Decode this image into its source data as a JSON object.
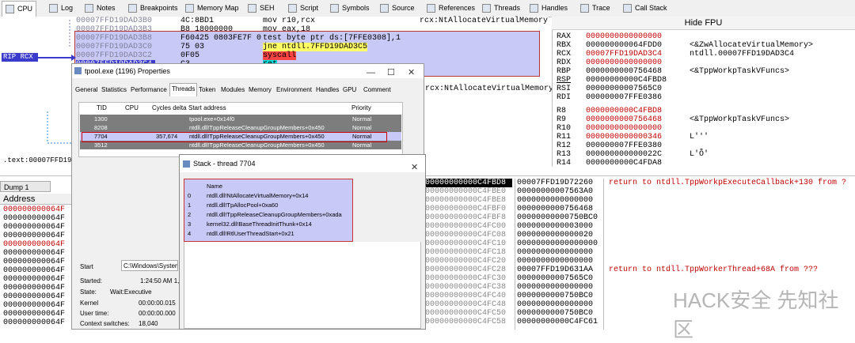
{
  "tabs": [
    {
      "label": "CPU",
      "icon": "cpu-icon",
      "active": true
    },
    {
      "label": "Log",
      "icon": "log-icon"
    },
    {
      "label": "Notes",
      "icon": "notes-icon"
    },
    {
      "label": "Breakpoints",
      "icon": "breakpoint-icon"
    },
    {
      "label": "Memory Map",
      "icon": "memory-map-icon"
    },
    {
      "label": "SEH",
      "icon": "seh-icon"
    },
    {
      "label": "Script",
      "icon": "script-icon"
    },
    {
      "label": "Symbols",
      "icon": "symbols-icon"
    },
    {
      "label": "Source",
      "icon": "source-icon"
    },
    {
      "label": "References",
      "icon": "references-icon"
    },
    {
      "label": "Threads",
      "icon": "threads-icon"
    },
    {
      "label": "Handles",
      "icon": "handles-icon"
    },
    {
      "label": "Trace",
      "icon": "trace-icon"
    },
    {
      "label": "Call Stack",
      "icon": "call-stack-icon"
    }
  ],
  "disasm": {
    "rows": [
      {
        "addr": "00007FFD19DAD3B0",
        "bytes": "4C:8BD1",
        "instr": "mov r10,rcx",
        "comment": "rcx:NtAllocateVirtualMemory"
      },
      {
        "addr": "00007FFD19DAD3B3",
        "bytes": "B8 18000000",
        "instr": "mov eax,18",
        "comment": ""
      },
      {
        "addr": "00007FFD19DAD3B8",
        "bytes": "F60425 0803FE7F 0",
        "instr": "test byte ptr ds:[7FFE0308],1",
        "comment": ""
      },
      {
        "addr": "00007FFD19DAD3C0",
        "bytes": "75 03",
        "instr": "jne ntdll.7FFD19DAD3C5",
        "comment": ""
      },
      {
        "addr": "00007FFD19DAD3C2",
        "bytes": "0F05",
        "instr": "syscall",
        "comment": ""
      },
      {
        "addr": "00007FFD19DAD3C4",
        "bytes": "C3",
        "instr": "ret",
        "comment": ""
      }
    ],
    "rip_label": "RIP RCX",
    "right_comment": "rcx:NtAllocateVirtualMemory",
    "text_label": ".text:00007FFD19DA"
  },
  "registers": {
    "header": "Hide FPU",
    "items": [
      {
        "name": "RAX",
        "value": "0000000000000000",
        "comment": ""
      },
      {
        "name": "RBX",
        "value": "000000000064FDD0",
        "comment": "<&ZwAllocateVirtualMemory>"
      },
      {
        "name": "RCX",
        "value": "00007FFD19DAD3C4",
        "comment": "ntdll.00007FFD19DAD3C4"
      },
      {
        "name": "RDX",
        "value": "0000000000000000",
        "comment": ""
      },
      {
        "name": "RBP",
        "value": "0000000000756468",
        "comment": "<&TppWorkpTaskVFuncs>"
      },
      {
        "name": "RSP",
        "value": "00000000000C4FBD8",
        "comment": ""
      },
      {
        "name": "RSI",
        "value": "00000000007565C0",
        "comment": ""
      },
      {
        "name": "RDI",
        "value": "000000007FFE0386",
        "comment": ""
      },
      {
        "name": "R8",
        "value": "0000000000C4FBD8",
        "comment": ""
      },
      {
        "name": "R9",
        "value": "0000000000756468",
        "comment": "<&TppWorkpTaskVFuncs>"
      },
      {
        "name": "R10",
        "value": "0000000000000000",
        "comment": ""
      },
      {
        "name": "R11",
        "value": "0000000000000346",
        "comment": "L'ʹ'"
      },
      {
        "name": "R12",
        "value": "000000007FFE0380",
        "comment": ""
      },
      {
        "name": "R13",
        "value": "000000000000022C",
        "comment": "L'Ȭ'"
      },
      {
        "name": "R14",
        "value": "0000000000C4FDA8",
        "comment": ""
      }
    ]
  },
  "dump": {
    "tab_label": "Dump 1",
    "header": "Address",
    "addresses": [
      "000000000064F",
      "000000000064F",
      "000000000064F",
      "000000000064F",
      "000000000064F",
      "000000000064F",
      "000000000064F",
      "000000000064F",
      "000000000064F",
      "000000000064F",
      "000000000064F",
      "000000000064F",
      "000000000064F",
      "000000000064F",
      "000000000064F"
    ]
  },
  "stack": {
    "addresses": [
      "00000000000C4FBD8",
      "00000000000C4FBE0",
      "00000000000C4FBE8",
      "00000000000C4FBF0",
      "00000000000C4FBF8",
      "00000000000C4FC00",
      "00000000000C4FC08",
      "00000000000C4FC10",
      "00000000000C4FC18",
      "00000000000C4FC20",
      "00000000000C4FC28",
      "00000000000C4FC30",
      "00000000000C4FC38",
      "00000000000C4FC40",
      "00000000000C4FC48",
      "00000000000C4FC50",
      "00000000000C4FC58"
    ],
    "values": [
      "00007FFD19D72260",
      "00000000007563A0",
      "0000000000000000",
      "0000000000756468",
      "00000000000750BC0",
      "0000000000003000",
      "0000000000000020",
      "00000000000000000",
      "0000000000000000",
      "0000000000000000",
      "00007FFD19D631AA",
      "00000000007565C0",
      "0000000000000000",
      "0000000000750BC0",
      "0000000000000000",
      "0000000000750BC0",
      "00000000000C4FC61"
    ],
    "comments": {
      "0": "return to ntdll.TppWorkpExecuteCallback+130 from ?",
      "10": "return to ntdll.TppWorkerThread+68A from ???"
    }
  },
  "props": {
    "title": "tpool.exe (1196) Properties",
    "tabs": [
      "General",
      "Statistics",
      "Performance",
      "Threads",
      "Token",
      "Modules",
      "Memory",
      "Environment",
      "Handles",
      "GPU",
      "Comment"
    ],
    "active_tab": "Threads",
    "columns": [
      "TID",
      "CPU",
      "Cycles delta",
      "Start address",
      "Priority"
    ],
    "threads": [
      {
        "tid": "1300",
        "cpu": "",
        "cycles": "",
        "start": "tpool.exe+0x14f0",
        "priority": "Normal"
      },
      {
        "tid": "8208",
        "cpu": "",
        "cycles": "",
        "start": "ntdll.dll!TppReleaseCleanupGroupMembers+0x450",
        "priority": "Normal"
      },
      {
        "tid": "7704",
        "cpu": "",
        "cycles": "357,674",
        "start": "ntdll.dll!TppReleaseCleanupGroupMembers+0x450",
        "priority": "Normal"
      },
      {
        "tid": "3512",
        "cpu": "",
        "cycles": "",
        "start": "ntdll.dll!TppReleaseCleanupGroupMembers+0x450",
        "priority": "Normal"
      }
    ],
    "start_label": "Start",
    "start_value": "C:\\Windows\\System",
    "started_label": "Started:",
    "started_value": "1:24:50 AM 1,",
    "state_label": "State:",
    "state_value": "Wait:Executive",
    "kernel_label": "Kernel",
    "kernel_value": "00:00:00.015",
    "user_label": "User time:",
    "user_value": "00:00:00.000",
    "ctx_label": "Context switches:",
    "ctx_value": "18,040"
  },
  "stackdlg": {
    "title": "Stack - thread 7704",
    "column": "Name",
    "frames": [
      {
        "idx": "0",
        "name": "ntdll.dll!NtAllocateVirtualMemory+0x14"
      },
      {
        "idx": "1",
        "name": "ntdll.dll!TpAllocPool+0xa60"
      },
      {
        "idx": "2",
        "name": "ntdll.dll!TppReleaseCleanupGroupMembers+0xada"
      },
      {
        "idx": "3",
        "name": "kernel32.dll!BaseThreadInitThunk+0x14"
      },
      {
        "idx": "4",
        "name": "ntdll.dll!RtlUserThreadStart+0x21"
      }
    ]
  },
  "watermark": "HACK安全 先知社区",
  "colors": {
    "selection": "#c9c9f7",
    "highlight_border": "#cc2222",
    "reg_value": "#c00000",
    "rip": "#3a3acc"
  }
}
